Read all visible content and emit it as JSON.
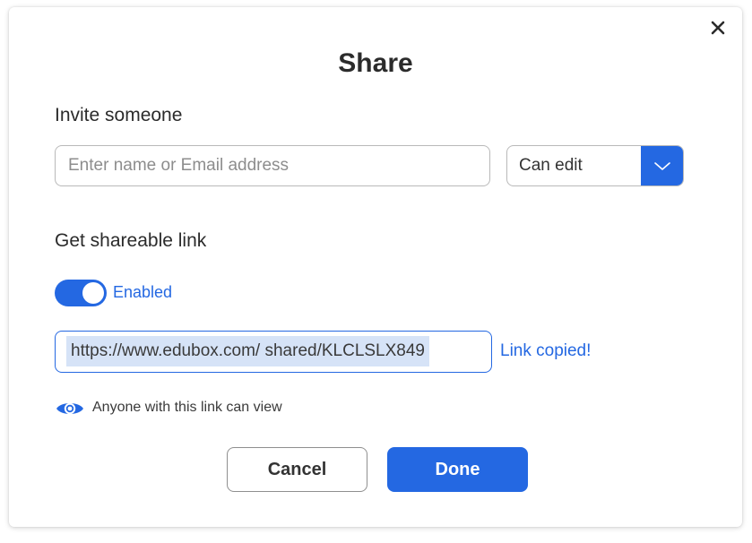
{
  "dialog": {
    "title": "Share",
    "close_icon": "close-icon"
  },
  "invite": {
    "label": "Invite someone",
    "placeholder": "Enter name or Email address",
    "value": "",
    "permission": {
      "selected": "Can edit",
      "icon": "chevron-down-icon"
    }
  },
  "share_link": {
    "label": "Get shareable link",
    "toggle_on": true,
    "toggle_label": "Enabled",
    "url": "https://www.edubox.com/ shared/KLCLSLX849",
    "copied_text": "Link copied!",
    "visibility_icon": "eye-icon",
    "visibility_note": "Anyone with this link can view"
  },
  "actions": {
    "cancel_label": "Cancel",
    "done_label": "Done"
  },
  "colors": {
    "accent": "#2468e2",
    "link_highlight": "#d6e3f7",
    "text": "#2b2b2b",
    "border": "#b9b9b9"
  }
}
